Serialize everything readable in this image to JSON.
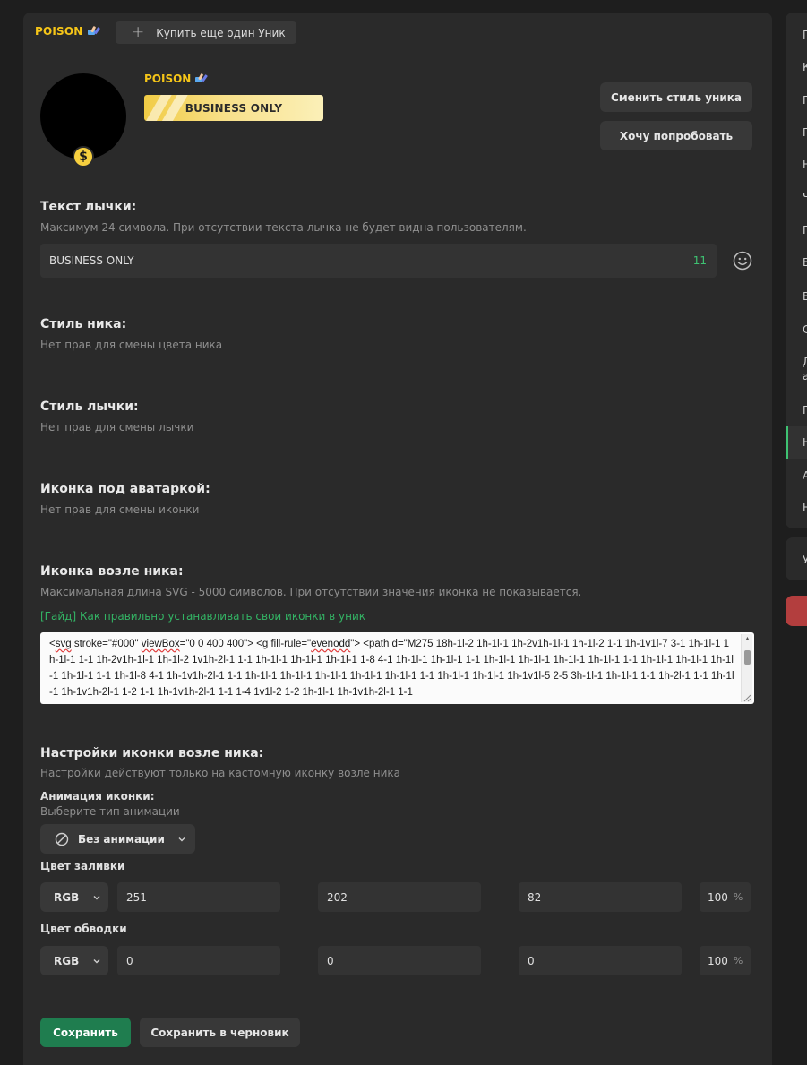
{
  "header": {
    "nick": "POISON",
    "buy_button": "Купить еще один Уник"
  },
  "profile": {
    "nick": "POISON",
    "badge_text": "BUSINESS ONLY",
    "change_style_button": "Сменить стиль уника",
    "try_button": "Хочу попробовать"
  },
  "badge_text_section": {
    "title": "Текст лычки:",
    "hint": "Максимум 24 символа. При отсутствии текста лычка не будет видна пользователям.",
    "value": "BUSINESS ONLY",
    "counter": "11"
  },
  "nick_style": {
    "title": "Стиль ника:",
    "hint": "Нет прав для смены цвета ника"
  },
  "badge_style": {
    "title": "Стиль лычки:",
    "hint": "Нет прав для смены лычки"
  },
  "avatar_icon": {
    "title": "Иконка под аватаркой:",
    "hint": "Нет прав для смены иконки"
  },
  "nick_icon": {
    "title": "Иконка возле ника:",
    "hint": "Максимальная длина SVG - 5000 символов. При отсутствии значения иконка не показывается.",
    "guide_link": "[Гайд] Как правильно устанавливать свои иконки в уник",
    "svg_parts": {
      "t1": "<",
      "w1": "svg",
      "t2": " stroke=\"#000\" ",
      "w2": "viewBox",
      "t3": "=\"0 0 400 400\"> <g fill-rule=\"",
      "w3": "evenodd",
      "t4": "\"> <path d=\"M275 18h-1l-2 1h-1l-1 1h-2v1h-1l-1 1h-1l-2 1-1 1h-1v1l-7 3-1 1h-1l-1 1h-1l-1 1-1 1h-2v1h-1l-1 1h-1l-2 1v1h-2l-1 1-1 1h-1l-1 1h-1l-1 1h-1l-1 1-8 4-1 1h-1l-1 1h-1l-1 1-1 1h-1l-1 1h-1l-1 1h-1l-1 1h-1l-1 1-1 1h-1l-1 1h-1l-1 1h-1l-1 1h-1l-1 1-1 1h-1l-8 4-1 1h-1v1h-2l-1 1-1 1h-1l-1 1h-1l-1 1h-1l-1 1h-1l-1 1h-1l-1 1-1 1h-1l-1 1h-1l-1 1h-1v1l-5 2-5 3h-1l-1 1h-1l-1 1-1 1h-2l-1 1-1 1h-1l-1 1h-1v1h-2l-1 1-2 1-1 1h-1v1h-2l-1 1-1 1-4 1v1l-2 1-2 1h-1l-1 1h-1v1h-2l-1 1-1"
    }
  },
  "nick_icon_settings": {
    "title": "Настройки иконки возле ника:",
    "hint": "Настройки действуют только на кастомную иконку возле ника",
    "animation_label": "Анимация иконки:",
    "animation_hint": "Выберите тип анимации",
    "animation_value": "Без анимации",
    "fill": {
      "label": "Цвет заливки",
      "mode": "RGB",
      "r": "251",
      "g": "202",
      "b": "82",
      "alpha": "100",
      "unit": "%"
    },
    "stroke": {
      "label": "Цвет обводки",
      "mode": "RGB",
      "r": "0",
      "g": "0",
      "b": "0",
      "alpha": "100",
      "unit": "%"
    }
  },
  "actions": {
    "save": "Сохранить",
    "save_draft": "Сохранить в черновик"
  },
  "right_nav": [
    "П",
    "К",
    "П",
    "П",
    "Н",
    "Ч",
    "П",
    "В",
    "В",
    "С",
    "Д",
    "а",
    "П",
    "Н",
    "А",
    "Н"
  ],
  "right_nav2": "У",
  "colors": {
    "accent": "#3ec272",
    "gold": "#f5c518",
    "save": "#1f7d4f"
  }
}
